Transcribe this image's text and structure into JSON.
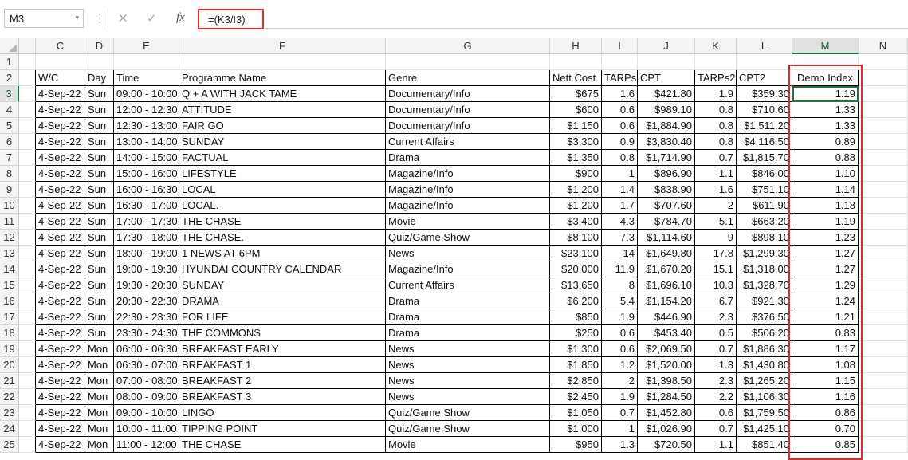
{
  "name_box": "M3",
  "formula": "=(K3/I3)",
  "toolbar_icons": [
    "cancel-icon",
    "enter-icon",
    "fx-icon"
  ],
  "toolbar_glyphs": {
    "dots": "⋮",
    "cancel": "✕",
    "enter": "✓",
    "fx": "fx",
    "caret": "▾"
  },
  "columns": [
    "C",
    "D",
    "E",
    "F",
    "G",
    "H",
    "I",
    "J",
    "K",
    "L",
    "M",
    "N"
  ],
  "row_numbers": [
    "1",
    "2",
    "3",
    "4",
    "5",
    "6",
    "7",
    "8",
    "9",
    "10",
    "11",
    "12",
    "13",
    "14",
    "15",
    "16",
    "17",
    "18",
    "19",
    "20",
    "21",
    "22",
    "23",
    "24",
    "25"
  ],
  "headers": [
    "W/C",
    "Day",
    "Time",
    "Programme Name",
    "Genre",
    "Nett Cost",
    "TARPs",
    "CPT",
    "TARPs2",
    "CPT2",
    "Demo Index"
  ],
  "rows": [
    [
      "4-Sep-22",
      "Sun",
      "09:00 - 10:00",
      "Q + A WITH JACK TAME",
      "Documentary/Info",
      "$675",
      "1.6",
      "$421.80",
      "1.9",
      "$359.30",
      "1.19"
    ],
    [
      "4-Sep-22",
      "Sun",
      "12:00 - 12:30",
      "ATTITUDE",
      "Documentary/Info",
      "$600",
      "0.6",
      "$989.10",
      "0.8",
      "$710.60",
      "1.33"
    ],
    [
      "4-Sep-22",
      "Sun",
      "12:30 - 13:00",
      "FAIR GO",
      "Documentary/Info",
      "$1,150",
      "0.6",
      "$1,884.90",
      "0.8",
      "$1,511.20",
      "1.33"
    ],
    [
      "4-Sep-22",
      "Sun",
      "13:00 - 14:00",
      "SUNDAY",
      "Current Affairs",
      "$3,300",
      "0.9",
      "$3,830.40",
      "0.8",
      "$4,116.50",
      "0.89"
    ],
    [
      "4-Sep-22",
      "Sun",
      "14:00 - 15:00",
      "FACTUAL",
      "Drama",
      "$1,350",
      "0.8",
      "$1,714.90",
      "0.7",
      "$1,815.70",
      "0.88"
    ],
    [
      "4-Sep-22",
      "Sun",
      "15:00 - 16:00",
      "LIFESTYLE",
      "Magazine/Info",
      "$900",
      "1",
      "$896.90",
      "1.1",
      "$846.00",
      "1.10"
    ],
    [
      "4-Sep-22",
      "Sun",
      "16:00 - 16:30",
      "LOCAL",
      "Magazine/Info",
      "$1,200",
      "1.4",
      "$838.90",
      "1.6",
      "$751.10",
      "1.14"
    ],
    [
      "4-Sep-22",
      "Sun",
      "16:30 - 17:00",
      "LOCAL.",
      "Magazine/Info",
      "$1,200",
      "1.7",
      "$707.60",
      "2",
      "$611.90",
      "1.18"
    ],
    [
      "4-Sep-22",
      "Sun",
      "17:00 - 17:30",
      "THE CHASE",
      "Movie",
      "$3,400",
      "4.3",
      "$784.70",
      "5.1",
      "$663.20",
      "1.19"
    ],
    [
      "4-Sep-22",
      "Sun",
      "17:30 - 18:00",
      "THE CHASE.",
      "Quiz/Game Show",
      "$8,100",
      "7.3",
      "$1,114.60",
      "9",
      "$898.10",
      "1.23"
    ],
    [
      "4-Sep-22",
      "Sun",
      "18:00 - 19:00",
      "1 NEWS AT 6PM",
      "News",
      "$23,100",
      "14",
      "$1,649.80",
      "17.8",
      "$1,299.30",
      "1.27"
    ],
    [
      "4-Sep-22",
      "Sun",
      "19:00 - 19:30",
      "HYUNDAI COUNTRY CALENDAR",
      "Magazine/Info",
      "$20,000",
      "11.9",
      "$1,670.20",
      "15.1",
      "$1,318.00",
      "1.27"
    ],
    [
      "4-Sep-22",
      "Sun",
      "19:30 - 20:30",
      "SUNDAY",
      "Current Affairs",
      "$13,650",
      "8",
      "$1,696.10",
      "10.3",
      "$1,328.70",
      "1.29"
    ],
    [
      "4-Sep-22",
      "Sun",
      "20:30 - 22:30",
      "DRAMA",
      "Drama",
      "$6,200",
      "5.4",
      "$1,154.20",
      "6.7",
      "$921.30",
      "1.24"
    ],
    [
      "4-Sep-22",
      "Sun",
      "22:30 - 23:30",
      "FOR LIFE",
      "Drama",
      "$850",
      "1.9",
      "$446.90",
      "2.3",
      "$376.50",
      "1.21"
    ],
    [
      "4-Sep-22",
      "Sun",
      "23:30 - 24:30",
      "THE COMMONS",
      "Drama",
      "$250",
      "0.6",
      "$453.40",
      "0.5",
      "$506.20",
      "0.83"
    ],
    [
      "4-Sep-22",
      "Mon",
      "06:00 - 06:30",
      "BREAKFAST EARLY",
      "News",
      "$1,300",
      "0.6",
      "$2,069.50",
      "0.7",
      "$1,886.30",
      "1.17"
    ],
    [
      "4-Sep-22",
      "Mon",
      "06:30 - 07:00",
      "BREAKFAST 1",
      "News",
      "$1,850",
      "1.2",
      "$1,520.00",
      "1.3",
      "$1,430.80",
      "1.08"
    ],
    [
      "4-Sep-22",
      "Mon",
      "07:00 - 08:00",
      "BREAKFAST 2",
      "News",
      "$2,850",
      "2",
      "$1,398.50",
      "2.3",
      "$1,265.20",
      "1.15"
    ],
    [
      "4-Sep-22",
      "Mon",
      "08:00 - 09:00",
      "BREAKFAST 3",
      "News",
      "$2,450",
      "1.9",
      "$1,284.50",
      "2.2",
      "$1,106.30",
      "1.16"
    ],
    [
      "4-Sep-22",
      "Mon",
      "09:00 - 10:00",
      "LINGO",
      "Quiz/Game Show",
      "$1,050",
      "0.7",
      "$1,452.80",
      "0.6",
      "$1,759.50",
      "0.86"
    ],
    [
      "4-Sep-22",
      "Mon",
      "10:00 - 11:00",
      "TIPPING POINT",
      "Quiz/Game Show",
      "$1,000",
      "1",
      "$1,026.90",
      "0.7",
      "$1,425.10",
      "0.70"
    ],
    [
      "4-Sep-22",
      "Mon",
      "11:00 - 12:00",
      "THE CHASE",
      "Movie",
      "$950",
      "1.3",
      "$720.50",
      "1.1",
      "$851.40",
      "0.85"
    ]
  ],
  "colors": {
    "highlight": "#e02a2a",
    "selection": "#217346"
  }
}
